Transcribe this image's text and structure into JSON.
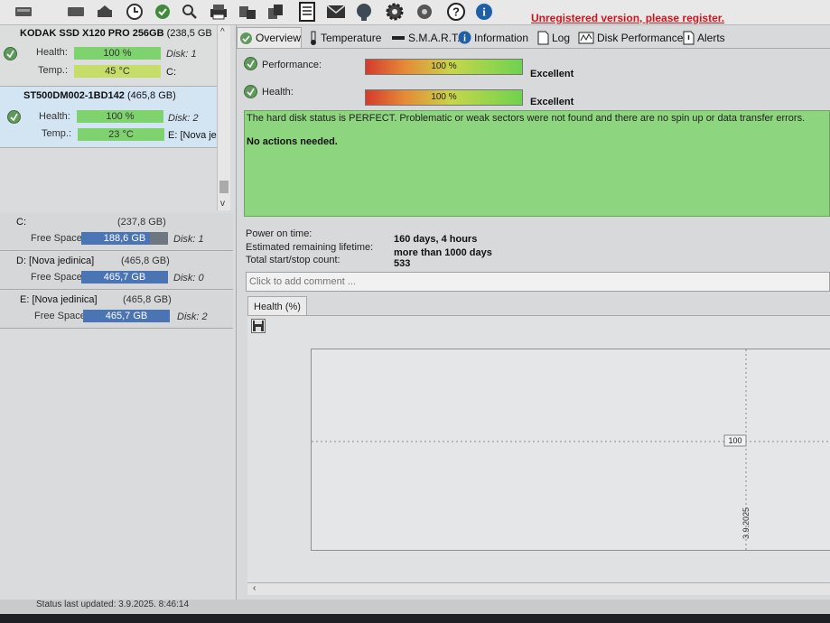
{
  "toolbar": {
    "buttons": [
      "disk-icon",
      "disk-icon",
      "clock-icon",
      "check-icon",
      "search-icon",
      "printer-icon",
      "tools-icon",
      "copy-icon",
      "list-icon",
      "mail-icon",
      "globe-icon",
      "gear-icon",
      "settings-icon",
      "help-icon",
      "info-icon"
    ],
    "unregistered": "Unregistered version, please register."
  },
  "disks": [
    {
      "name": "KODAK SSD X120 PRO 256GB",
      "size": "(238,5 GB",
      "health_label": "Health:",
      "health": "100 %",
      "temp_label": "Temp.:",
      "temp": "45 °C",
      "disk_num": "Disk: 1",
      "mount": "C:"
    },
    {
      "name": "ST500DM002-1BD142",
      "size": "(465,8 GB)",
      "health_label": "Health:",
      "health": "100 %",
      "temp_label": "Temp.:",
      "temp": "23 °C",
      "disk_num": "Disk: 2",
      "mount": "E: [Nova je"
    }
  ],
  "volumes": [
    {
      "name": "C:",
      "size": "(237,8 GB)",
      "free_label": "Free Space",
      "free": "188,6 GB",
      "free_fraction": 0.79,
      "disk": "Disk: 1"
    },
    {
      "name": "D: [Nova jedinica]",
      "size": "(465,8 GB)",
      "free_label": "Free Space",
      "free": "465,7 GB",
      "free_fraction": 1.0,
      "disk": "Disk: 0"
    },
    {
      "name": "E: [Nova jedinica]",
      "size": "(465,8 GB)",
      "free_label": "Free Space",
      "free": "465,7 GB",
      "free_fraction": 1.0,
      "disk": "Disk: 2"
    }
  ],
  "status_bar": "Status last updated: 3.9.2025. 8:46:14",
  "tabs": [
    "Overview",
    "Temperature",
    "S.M.A.R.T.",
    "Information",
    "Log",
    "Disk Performance",
    "Alerts"
  ],
  "overview": {
    "performance_label": "Performance:",
    "performance_value": "100 %",
    "performance_rating": "Excellent",
    "health_label": "Health:",
    "health_value": "100 %",
    "health_rating": "Excellent",
    "status_message": "The hard disk status is PERFECT. Problematic or weak sectors were not found and there are no spin up or data transfer errors.",
    "status_action": "No actions needed.",
    "power_on_label": "Power on time:",
    "power_on_value": "160 days, 4 hours",
    "lifetime_label": "Estimated remaining lifetime:",
    "lifetime_value": "more than 1000 days",
    "startstop_label": "Total start/stop count:",
    "startstop_value": "533",
    "comment_placeholder": "Click to add comment ..."
  },
  "graph": {
    "tab_label": "Health (%)",
    "y_tick": "100",
    "point_label": "100",
    "x_tick": "3.9.2025"
  },
  "bottom_scroll": "‹",
  "colors": {
    "status_green": "#8ed57f",
    "unregistered_red": "#d0161d",
    "selected_disk": "#d3e4f2",
    "free_bar": "#4a74b4"
  }
}
